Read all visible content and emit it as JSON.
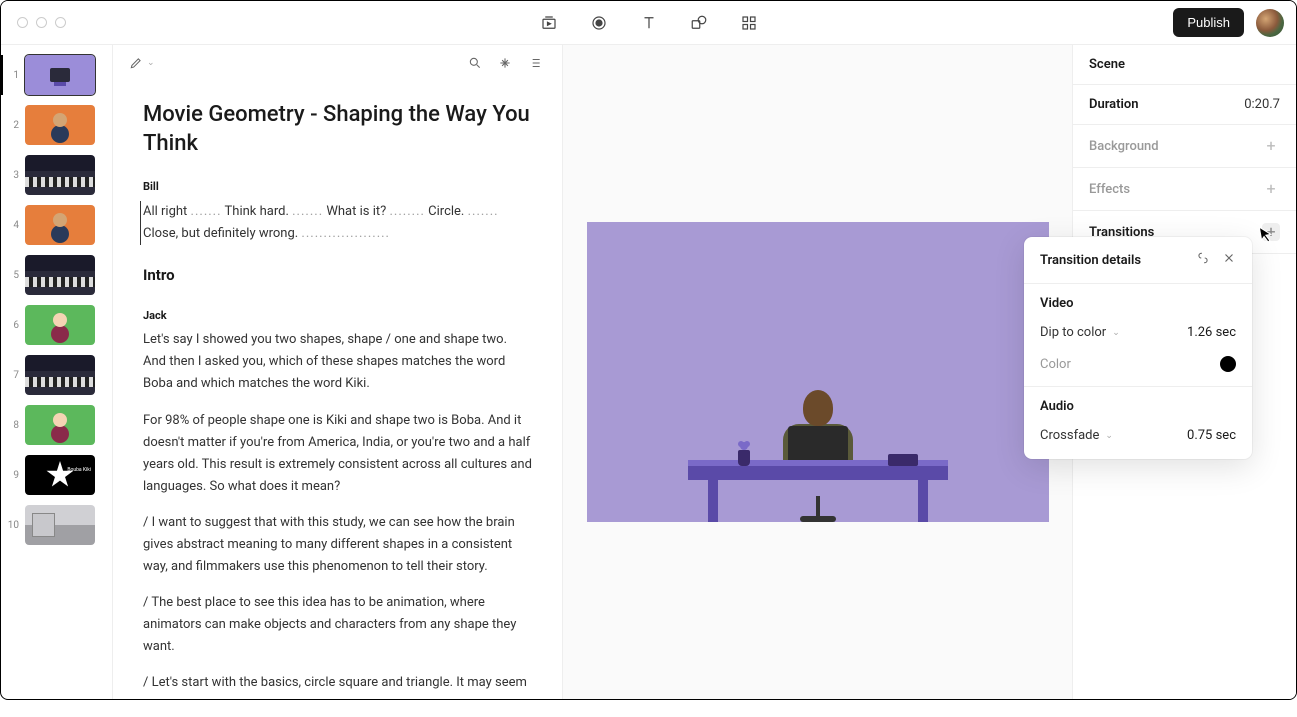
{
  "header": {
    "publish_label": "Publish"
  },
  "thumbs": [
    {
      "num": "1"
    },
    {
      "num": "2"
    },
    {
      "num": "3"
    },
    {
      "num": "4"
    },
    {
      "num": "5"
    },
    {
      "num": "6"
    },
    {
      "num": "7"
    },
    {
      "num": "8"
    },
    {
      "num": "9"
    },
    {
      "num": "10"
    }
  ],
  "document": {
    "title": "Movie Geometry - Shaping the Way You Think",
    "speaker1": "Bill",
    "line1_a": "All right",
    "line1_b": "Think hard.",
    "line1_c": "What is it?",
    "line1_d": "Circle.",
    "line1_e": "Close, but definitely wrong.",
    "section_intro": "Intro",
    "speaker2": "Jack",
    "para1": "Let's say I showed you two shapes, shape / one and shape two. And then I asked you, which of these shapes matches the word Boba and which matches the word Kiki.",
    "para2": "For 98% of people shape one is Kiki and shape two is Boba. And it doesn't matter if you're from America, India, or you're two and a half years old. This result is extremely consistent across all cultures and languages. So what does it mean?",
    "para3": "/ I want to suggest that with this study, we can see how the brain gives abstract meaning to many different shapes in a consistent way, and filmmakers use this phenomenon to tell their story.",
    "para4": "/ The best place to see this idea has to be animation, where animators can make objects and characters from any shape they want.",
    "para5": "/ Let's start with the basics, circle square and triangle. It may seem"
  },
  "inspector": {
    "scene_label": "Scene",
    "duration_label": "Duration",
    "duration_value": "0:20.7",
    "background_label": "Background",
    "effects_label": "Effects",
    "transitions_label": "Transitions"
  },
  "popover": {
    "title": "Transition details",
    "video_label": "Video",
    "video_type": "Dip to color",
    "video_duration": "1.26 sec",
    "color_label": "Color",
    "color_value": "#000000",
    "audio_label": "Audio",
    "audio_type": "Crossfade",
    "audio_duration": "0.75 sec"
  },
  "thumb9_label": "Bouba\nKiki"
}
